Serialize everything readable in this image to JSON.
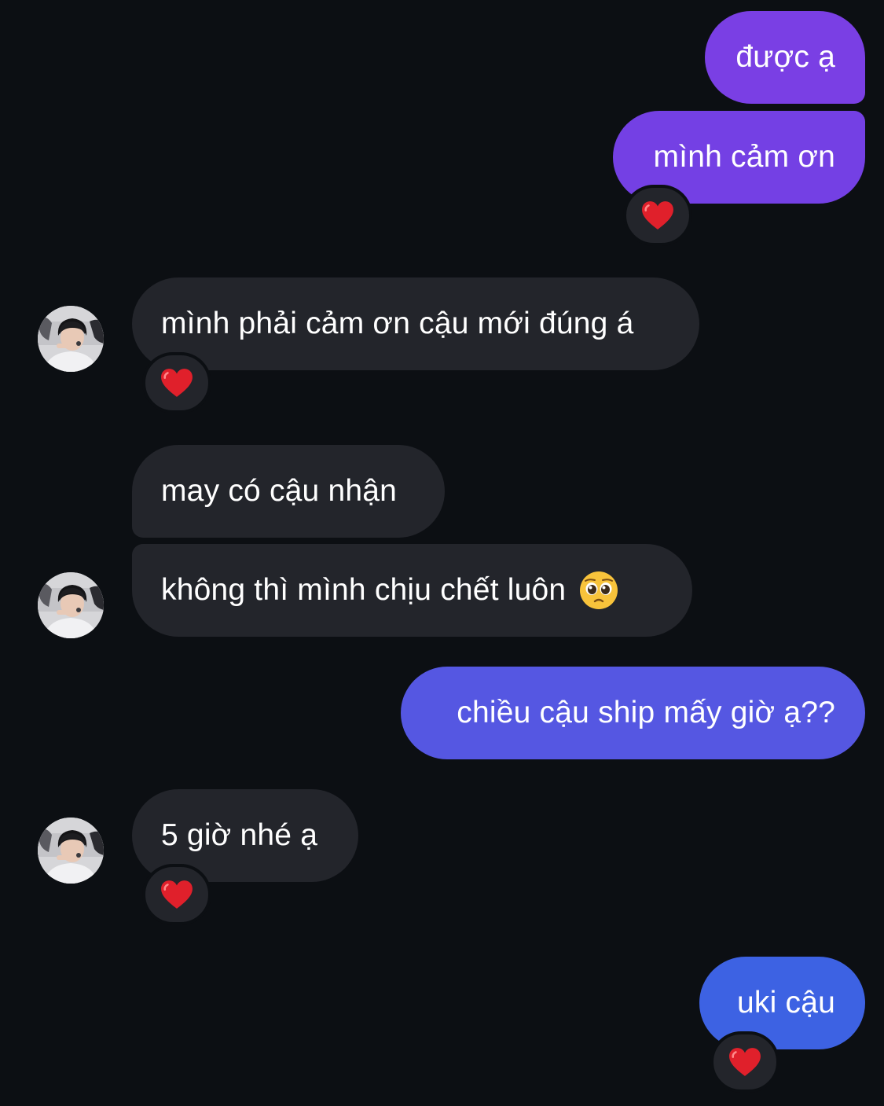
{
  "conversation": {
    "messages": [
      {
        "sender": "me",
        "text": "được ạ"
      },
      {
        "sender": "me",
        "text": "mình cảm ơn",
        "reaction": "heart-icon"
      },
      {
        "sender": "them",
        "text": "mình phải cảm ơn cậu mới đúng á",
        "reaction": "heart-icon"
      },
      {
        "sender": "them",
        "text": "may có cậu nhận"
      },
      {
        "sender": "them",
        "text": "không thì mình chịu chết luôn",
        "emoji": "pleading-face-icon"
      },
      {
        "sender": "me",
        "text": "chiều cậu ship mấy giờ ạ??"
      },
      {
        "sender": "them",
        "text": "5 giờ nhé ạ",
        "reaction": "heart-icon"
      },
      {
        "sender": "me",
        "text": "uki cậu",
        "reaction": "heart-icon"
      }
    ]
  },
  "colors": {
    "background": "#0c0f13",
    "incoming_bubble": "#23252b",
    "outgoing_gradient_top": "#7a3fe4",
    "outgoing_gradient_mid": "#5557e2",
    "outgoing_gradient_bottom": "#3d62e3",
    "reaction_heart": "#e0202b"
  }
}
